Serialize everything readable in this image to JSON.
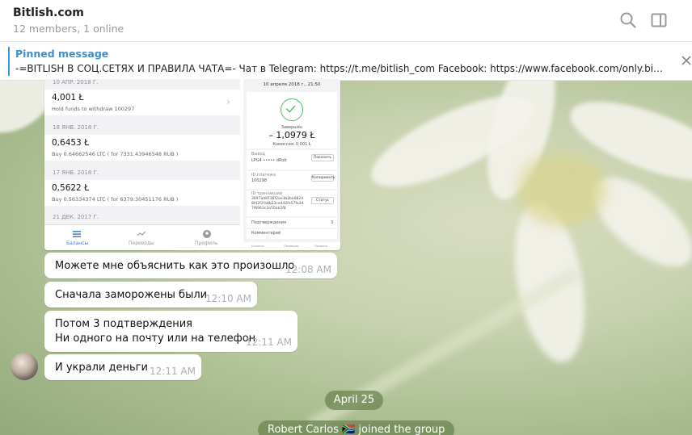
{
  "header": {
    "title": "Bitlish.com",
    "subtitle": "12 members, 1 online"
  },
  "pinned": {
    "title": "Pinned message",
    "text": "-=BITLISH В СОЦ.СЕТЯХ И ПРАВИЛА ЧАТА=-  Чат в Telegram: https://t.me/bitlish_com  Facebook: https://www.facebook.com/only.bi…"
  },
  "screenshot_image": {
    "left": {
      "top_date": "10 АПР. 2018 Г.",
      "rows": [
        {
          "date": "",
          "amount": "4,001 Ł",
          "desc": "Hold funds to withdraw 100297"
        },
        {
          "date": "18 ЯНВ. 2018 Г.",
          "amount": "0,6453 Ł",
          "desc": "Buy 0.64662546 LTC ( for 7331.43946548 RUB )"
        },
        {
          "date": "17 ЯНВ. 2018 Г.",
          "amount": "0,5622 Ł",
          "desc": "Buy 0.56334374 LTC ( for 6379.30451176 RUB )"
        }
      ],
      "last_date": "21 ДЕК. 2017 Г.",
      "tabs": [
        "Балансы",
        "Переводы",
        "Профиль"
      ]
    },
    "right": {
      "header": "10 апреля 2018 г., 21:50",
      "status": "Завершён",
      "amount": "– 1,0979 Ł",
      "fee": "Комиссия: 0,001 Ł",
      "fields": [
        {
          "label": "Вывод",
          "value": "LPG4 ••••• dRub",
          "button": "Показать"
        },
        {
          "label": "ID платежа",
          "value": "100298",
          "button": "Копировать"
        },
        {
          "label": "ID транзакции",
          "value": "3697ad8736f2ae3b2ba682d\n8f42f2fa8b23ce442fe57fa3d\n7f6963c2e50ab2f8",
          "button": "Статус"
        },
        {
          "label": "Подтверждения",
          "value": "3",
          "button": ""
        },
        {
          "label": "Комментарий",
          "value": "",
          "button": ""
        }
      ],
      "tabs": [
        "Балансы",
        "Переводы",
        "Профиль"
      ]
    }
  },
  "messages": [
    {
      "lines": [
        "Можете мне объяснить как это произошло"
      ],
      "time": "12:08 AM"
    },
    {
      "lines": [
        "Сначала заморожены были"
      ],
      "time": "12:10 AM"
    },
    {
      "lines": [
        "Потом 3 подтверждения",
        "Ни одного на почту или на телефон"
      ],
      "time": "12:11 AM"
    },
    {
      "lines": [
        "И украли деньги"
      ],
      "time": "12:11 AM"
    }
  ],
  "date_separator": "April 25",
  "service_message": "Robert Carlos 🇿🇦 joined the group",
  "colors": {
    "accent": "#3d8fd1",
    "success": "#4cbb5f",
    "pill": "#6b8450"
  }
}
